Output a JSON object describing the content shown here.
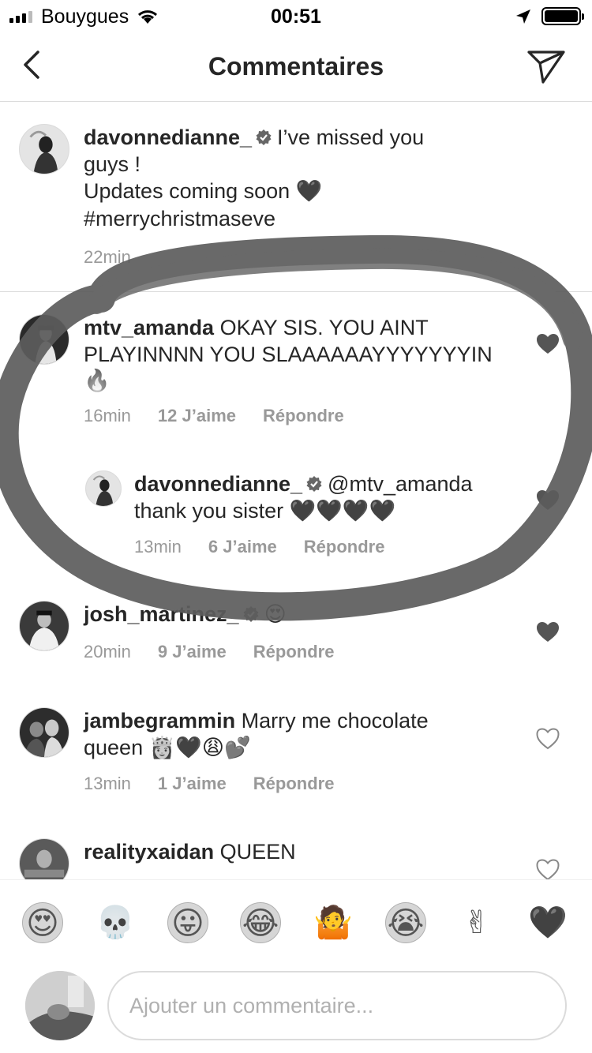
{
  "status_bar": {
    "carrier": "Bouygues",
    "time": "00:51"
  },
  "nav": {
    "title": "Commentaires"
  },
  "caption": {
    "username": "davonnedianne_",
    "line1": "I’ve missed you",
    "line2": "guys !",
    "line3": "Updates coming soon",
    "hashtag": "#merrychristmaseve",
    "time": "22min"
  },
  "comments": [
    {
      "username": "mtv_amanda",
      "line1": "OKAY SIS. YOU AINT",
      "line2": "PLAYINNNN YOU SLAAAAAAYYYYYYYIN",
      "emoji": "🔥",
      "time": "16min",
      "likes": "12 J’aime",
      "reply": "Répondre"
    },
    {
      "username": "davonnedianne_",
      "mention": "@mtv_amanda",
      "line2": "thank you sister",
      "emoji": "🖤🖤🖤🖤",
      "time": "13min",
      "likes": "6 J’aime",
      "reply": "Répondre"
    },
    {
      "username": "josh_martinez_",
      "emoji": "😍",
      "time": "20min",
      "likes": "9 J’aime",
      "reply": "Répondre"
    },
    {
      "username": "jambegrammin",
      "line1": "Marry me chocolate",
      "line2": "queen",
      "emoji": "👸🖤😩💕",
      "time": "13min",
      "likes": "1 J’aime",
      "reply": "Répondre"
    },
    {
      "username": "realityxaidan",
      "line1": "QUEEN"
    }
  ],
  "emoji_bar": [
    "😍",
    "💀",
    "😛",
    "😂",
    "🤷",
    "😭",
    "✌",
    "🖤"
  ],
  "composer": {
    "placeholder": "Ajouter un commentaire..."
  }
}
